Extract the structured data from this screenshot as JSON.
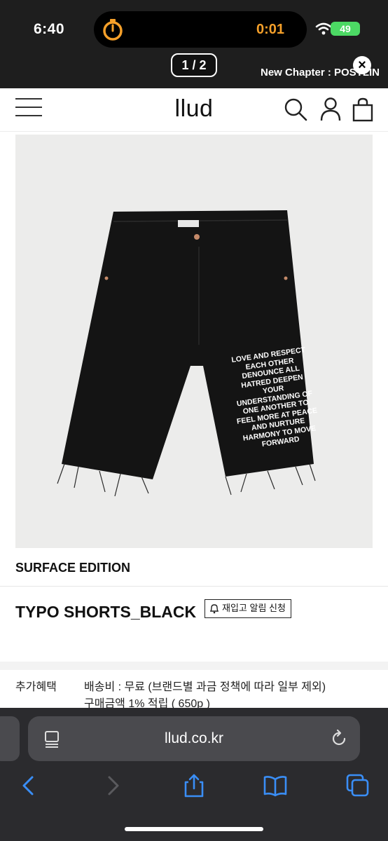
{
  "status_bar": {
    "time": "6:40",
    "timer": "0:01",
    "battery": "49"
  },
  "viewer": {
    "page_indicator": "1 / 2",
    "chapter_text": "New Chapter : POSTLIN",
    "close_label": "×"
  },
  "site": {
    "logo": "llud"
  },
  "product": {
    "print_text": [
      "LOVE AND RESPECT",
      "EACH OTHER",
      "DENOUNCE ALL",
      "HATRED DEEPEN",
      "YOUR",
      "UNDERSTANDING OF",
      "ONE ANOTHER TO",
      "FEEL MORE AT PEACE",
      "AND NURTURE",
      "HARMONY TO MOVE",
      "FORWARD"
    ],
    "brand": "SURFACE EDITION",
    "title": "TYPO SHORTS_BLACK",
    "restock_label": "재입고 알림 신청",
    "benefit_label": "추가혜택",
    "shipping_line": "배송비 : 무료 (브랜드별 과금 정책에 따라 일부 제외)",
    "points_line": "구매금액 1% 적립 ( 650p )"
  },
  "browser": {
    "url": "llud.co.kr"
  },
  "colors": {
    "overlay": "#1e1e1e",
    "timer_orange": "#f5a02a",
    "battery_green": "#4cd964",
    "safari_bar": "#2b2b2e",
    "safari_blue": "#3a8ef6"
  }
}
